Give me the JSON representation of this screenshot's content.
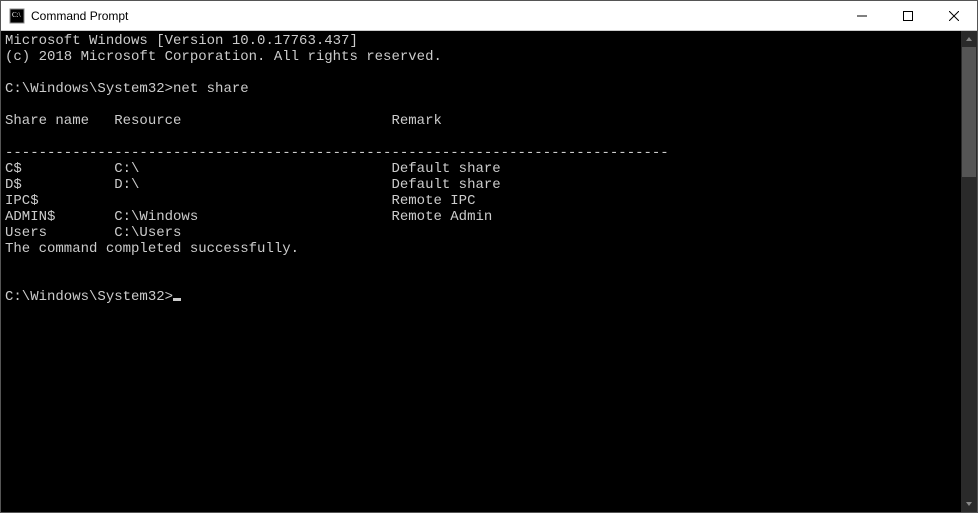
{
  "window": {
    "title": "Command Prompt"
  },
  "terminal": {
    "banner_line1": "Microsoft Windows [Version 10.0.17763.437]",
    "banner_line2": "(c) 2018 Microsoft Corporation. All rights reserved.",
    "prompt1_path": "C:\\Windows\\System32>",
    "prompt1_command": "net share",
    "header_share": "Share name",
    "header_resource": "Resource",
    "header_remark": "Remark",
    "divider": "-------------------------------------------------------------------------------",
    "rows": [
      {
        "share": "C$",
        "resource": "C:\\",
        "remark": "Default share"
      },
      {
        "share": "D$",
        "resource": "D:\\",
        "remark": "Default share"
      },
      {
        "share": "IPC$",
        "resource": "",
        "remark": "Remote IPC"
      },
      {
        "share": "ADMIN$",
        "resource": "C:\\Windows",
        "remark": "Remote Admin"
      },
      {
        "share": "Users",
        "resource": "C:\\Users",
        "remark": ""
      }
    ],
    "completion_msg": "The command completed successfully.",
    "prompt2_path": "C:\\Windows\\System32>"
  }
}
